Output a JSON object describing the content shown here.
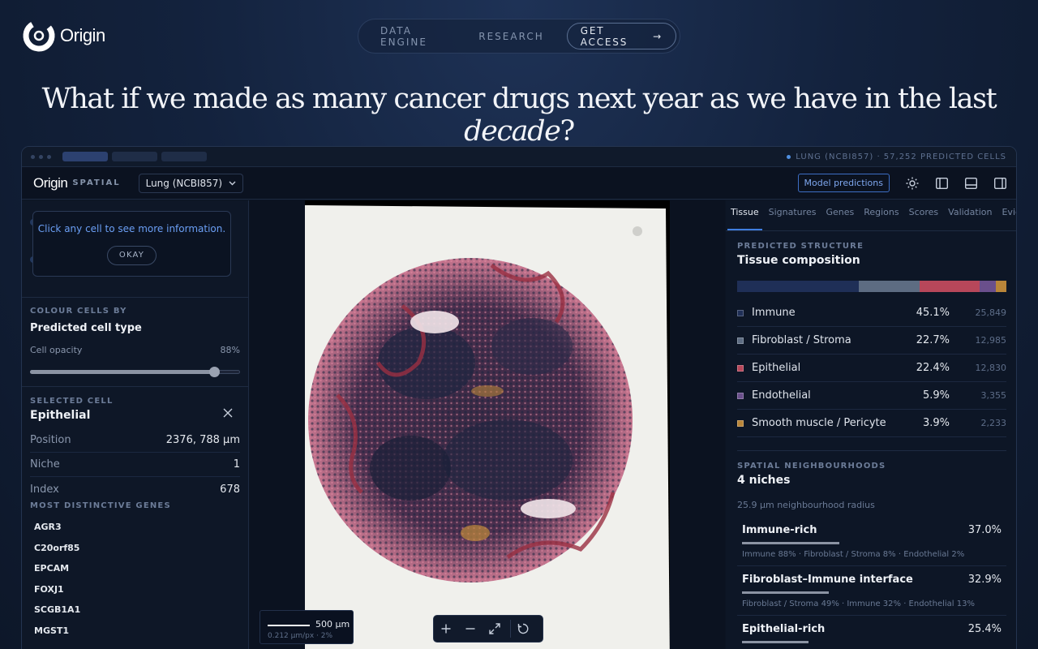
{
  "brand": {
    "name": "Origin"
  },
  "nav": {
    "links": [
      "DATA ENGINE",
      "RESEARCH"
    ],
    "cta": "GET ACCESS",
    "cta_arrow": "→"
  },
  "headline": {
    "before": "What if we made as many cancer drugs next year as we have in the last ",
    "em": "decade",
    "after": "?"
  },
  "app": {
    "status": "LUNG (NCBI857) · 57,252 PREDICTED CELLS",
    "brand": "Origin",
    "brand_sub": "SPATIAL",
    "dataset": "Lung (NCBI857)",
    "model_button": "Model predictions",
    "tooltip": {
      "message": "Click any cell to see more information.",
      "ok": "OKAY"
    },
    "colour": {
      "label": "COLOUR CELLS BY",
      "value": "Predicted cell type",
      "opacity_label": "Cell opacity",
      "opacity_value": "88%",
      "opacity_fraction": 0.88
    },
    "selected": {
      "label": "SELECTED CELL",
      "type": "Epithelial",
      "fields": [
        {
          "k": "Position",
          "v": "2376, 788 µm"
        },
        {
          "k": "Niche",
          "v": "1"
        },
        {
          "k": "Index",
          "v": "678"
        }
      ],
      "genes_label": "MOST DISTINCTIVE GENES",
      "genes": [
        "AGR3",
        "C20orf85",
        "EPCAM",
        "FOXJ1",
        "SCGB1A1",
        "MGST1"
      ]
    },
    "scale": {
      "value": "500 µm",
      "sub": "0.212 µm/px · 2%"
    },
    "tabs": [
      "Tissue",
      "Signatures",
      "Genes",
      "Regions",
      "Scores",
      "Validation",
      "Evidence"
    ],
    "composition": {
      "label": "PREDICTED STRUCTURE",
      "title": "Tissue composition",
      "rows": [
        {
          "name": "Immune",
          "pct": "45.1%",
          "count": "25,849",
          "value": 45.1,
          "color": "#1f2f57"
        },
        {
          "name": "Fibroblast / Stroma",
          "pct": "22.7%",
          "count": "12,985",
          "value": 22.7,
          "color": "#5d6c82"
        },
        {
          "name": "Epithelial",
          "pct": "22.4%",
          "count": "12,830",
          "value": 22.4,
          "color": "#b7475a"
        },
        {
          "name": "Endothelial",
          "pct": "5.9%",
          "count": "3,355",
          "value": 5.9,
          "color": "#6a4f8c"
        },
        {
          "name": "Smooth muscle / Pericyte",
          "pct": "3.9%",
          "count": "2,233",
          "value": 3.9,
          "color": "#b98539"
        }
      ]
    },
    "niches": {
      "label": "SPATIAL NEIGHBOURHOODS",
      "title": "4 niches",
      "radius": "25.9 µm neighbourhood radius",
      "items": [
        {
          "name": "Immune-rich",
          "pct": "37.0%",
          "value": 37.0,
          "desc": "Immune 88% · Fibroblast / Stroma 8% · Endothelial 2%"
        },
        {
          "name": "Fibroblast–Immune interface",
          "pct": "32.9%",
          "value": 32.9,
          "desc": "Fibroblast / Stroma 49% · Immune 32% · Endothelial 13%"
        },
        {
          "name": "Epithelial-rich",
          "pct": "25.4%",
          "value": 25.4,
          "desc": ""
        }
      ]
    }
  }
}
